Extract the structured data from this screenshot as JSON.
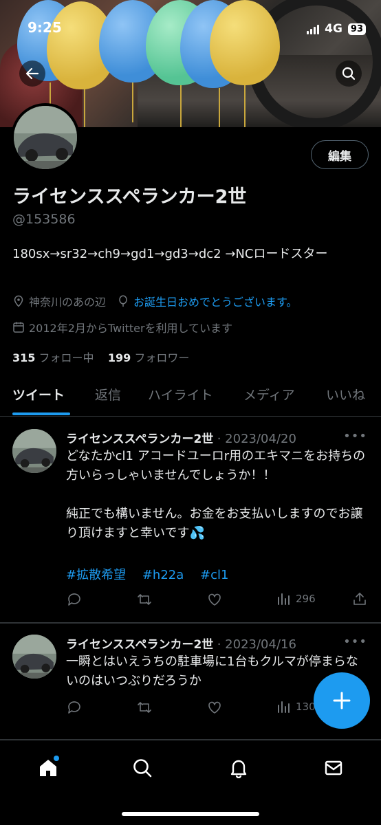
{
  "status_bar": {
    "time": "9:25",
    "network": "4G",
    "battery": "93"
  },
  "profile": {
    "edit_label": "編集",
    "name": "ライセンススペランカー2世",
    "handle": "@153586",
    "bio": "180sx→sr32→ch9→gd1→gd3→dc2 →NCロードスター",
    "location": "神奈川のあの辺",
    "birthday_text": "お誕生日おめでとうございます。",
    "joined": "2012年2月からTwitterを利用しています",
    "following_count": "315",
    "following_label": "フォロー中",
    "followers_count": "199",
    "followers_label": "フォロワー"
  },
  "tabs": [
    {
      "label": "ツイート",
      "active": true
    },
    {
      "label": "返信"
    },
    {
      "label": "ハイライト"
    },
    {
      "label": "メディア"
    },
    {
      "label": "いいね"
    }
  ],
  "tweets": [
    {
      "name": "ライセンススペランカー2世",
      "date": "· 2023/04/20",
      "text": "どなたかcl1 アコードユーロr用のエキマニをお持ちの方いらっしゃいませんでしょうか！！\n\n純正でも構いません。お金をお支払いしますのでお譲り頂けますと幸いです💦",
      "hashtags": [
        "#拡散希望",
        "#h22a",
        "#cl1"
      ],
      "views": "296"
    },
    {
      "name": "ライセンススペランカー2世",
      "date": "· 2023/04/16",
      "text": "一瞬とはいえうちの駐車場に1台もクルマが停まらないのはいつぶりだろうか",
      "views": "130"
    }
  ],
  "more_glyph": "•••",
  "colors": {
    "accent": "#1d9bf0",
    "muted": "#71767b",
    "text": "#e7e9ea",
    "divider": "#2f3336"
  }
}
